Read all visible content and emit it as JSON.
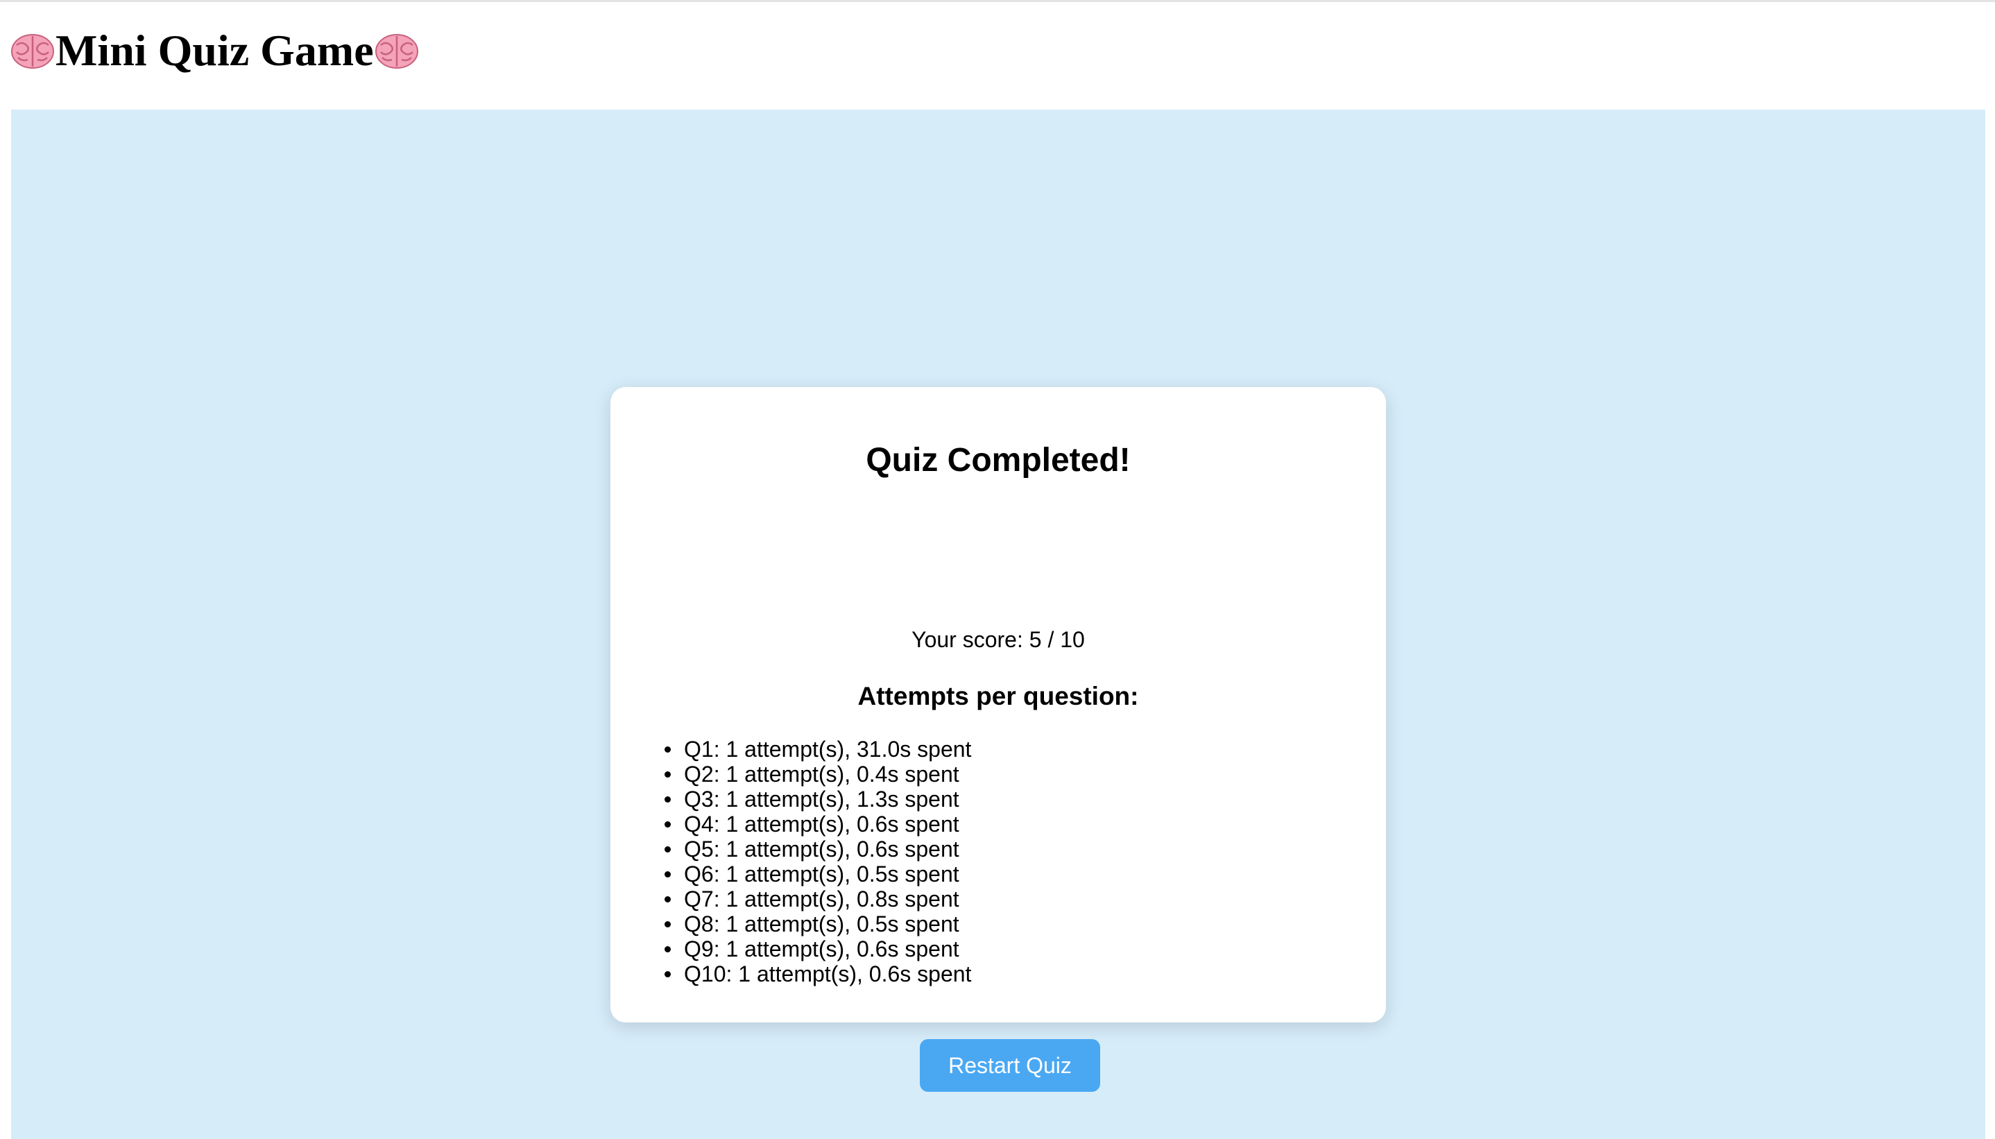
{
  "header": {
    "title": "Mini Quiz Game",
    "left_icon": "brain-icon",
    "right_icon": "brain-icon"
  },
  "result": {
    "title": "Quiz Completed!",
    "score_label": "Your score: 5 / 10",
    "attempts_heading": "Attempts per question:",
    "attempts": [
      "Q1: 1 attempt(s), 31.0s spent",
      "Q2: 1 attempt(s), 0.4s spent",
      "Q3: 1 attempt(s), 1.3s spent",
      "Q4: 1 attempt(s), 0.6s spent",
      "Q5: 1 attempt(s), 0.6s spent",
      "Q6: 1 attempt(s), 0.5s spent",
      "Q7: 1 attempt(s), 0.8s spent",
      "Q8: 1 attempt(s), 0.5s spent",
      "Q9: 1 attempt(s), 0.6s spent",
      "Q10: 1 attempt(s), 0.6s spent"
    ],
    "restart_label": "Restart Quiz"
  },
  "colors": {
    "stage_background": "#d6ecf9",
    "card_background": "#ffffff",
    "button_background": "#4aa8f3",
    "button_text": "#ffffff",
    "brain_pink": "#f4a3b8"
  }
}
